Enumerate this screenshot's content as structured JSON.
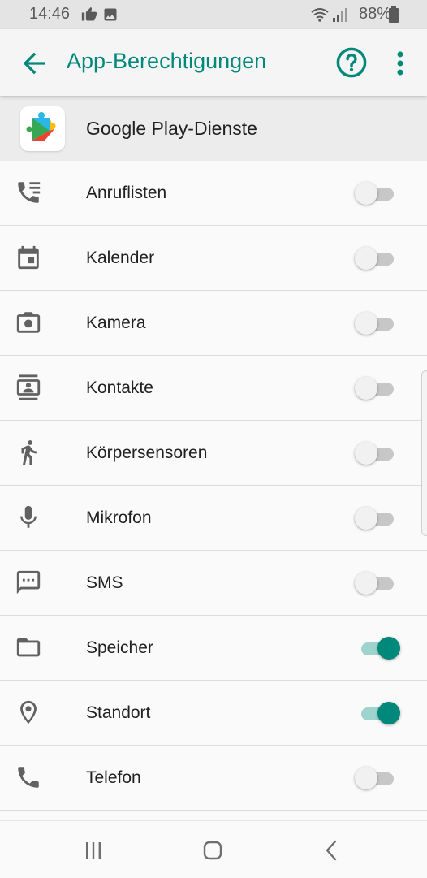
{
  "status_bar": {
    "time": "14:46",
    "battery_percent": "88%",
    "icons": [
      "thumbs-up-icon",
      "image-icon",
      "wifi-icon",
      "signal-icon",
      "battery-icon"
    ]
  },
  "app_bar": {
    "title": "App-Berechtigungen",
    "icons": [
      "back-arrow-icon",
      "help-icon",
      "more-vert-icon"
    ]
  },
  "app": {
    "name": "Google Play-Dienste",
    "icon": "google-play-services-icon"
  },
  "permissions": [
    {
      "label": "Anruflisten",
      "icon": "call-log-icon",
      "enabled": false
    },
    {
      "label": "Kalender",
      "icon": "calendar-icon",
      "enabled": false
    },
    {
      "label": "Kamera",
      "icon": "camera-icon",
      "enabled": false
    },
    {
      "label": "Kontakte",
      "icon": "contacts-icon",
      "enabled": false
    },
    {
      "label": "Körpersensoren",
      "icon": "body-sensors-icon",
      "enabled": false
    },
    {
      "label": "Mikrofon",
      "icon": "microphone-icon",
      "enabled": false
    },
    {
      "label": "SMS",
      "icon": "sms-icon",
      "enabled": false
    },
    {
      "label": "Speicher",
      "icon": "folder-icon",
      "enabled": true
    },
    {
      "label": "Standort",
      "icon": "location-icon",
      "enabled": true
    },
    {
      "label": "Telefon",
      "icon": "phone-icon",
      "enabled": false
    }
  ],
  "nav_bar": {
    "icons": [
      "recents-icon",
      "home-icon",
      "back-icon"
    ]
  },
  "colors": {
    "accent": "#00897b",
    "toggle_on_track": "#9fd3cd",
    "toggle_off_track": "#c7c7c7"
  }
}
